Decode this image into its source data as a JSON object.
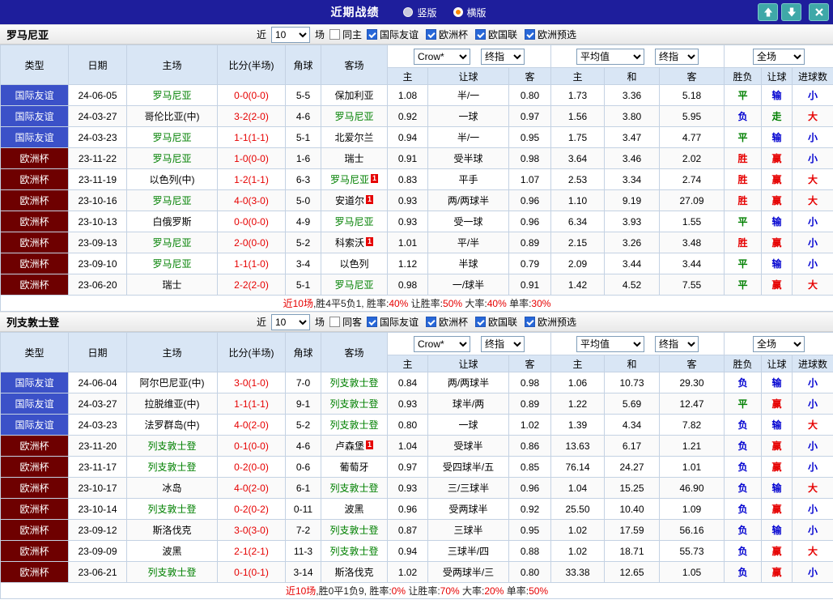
{
  "titlebar": {
    "title": "近期战绩",
    "radios": [
      {
        "label": "竖版",
        "selected": false
      },
      {
        "label": "横版",
        "selected": true
      }
    ]
  },
  "controls": {
    "near_label": "近",
    "count": "10",
    "games_label": "场",
    "bookmaker": "Crow*",
    "close_label": "终指",
    "average": "平均值",
    "fullcourt": "全场"
  },
  "filters": [
    "国际友谊",
    "欧洲杯",
    "欧国联",
    "欧洲预选"
  ],
  "table_headers": {
    "type": "类型",
    "date": "日期",
    "home": "主场",
    "score": "比分(半场)",
    "corner": "角球",
    "away": "客场",
    "a_home": "主",
    "a_handicap": "让球",
    "a_away": "客",
    "e_home": "主",
    "e_draw": "和",
    "e_away": "客",
    "result": "胜负",
    "handicap_result": "让球",
    "goals": "进球数"
  },
  "colors": {
    "titlebar_bg": "#1e1e9c",
    "type_friendly": "#3b51c8",
    "type_eurocup": "#6e0000",
    "team_green": "#008000",
    "red": "#e60000",
    "blue": "#0000d0",
    "green": "#008000",
    "result_map": {
      "胜": "#e60000",
      "平": "#008000",
      "负": "#0000d0",
      "赢": "#e60000",
      "走": "#008000",
      "输": "#0000d0",
      "大": "#e60000",
      "小": "#0000d0"
    }
  },
  "sections": [
    {
      "team": "罗马尼亚",
      "same_label": "同主",
      "rows": [
        {
          "type": "国际友谊",
          "tstyle": "friendly",
          "date": "24-06-05",
          "home": "罗马尼亚",
          "hg": true,
          "hb": false,
          "score": "0-0(0-0)",
          "corner": "5-5",
          "away": "保加利亚",
          "ag": false,
          "ab": false,
          "asian": [
            "1.08",
            "半/一",
            "0.80"
          ],
          "euro": [
            "1.73",
            "3.36",
            "5.18"
          ],
          "results": [
            "平",
            "输",
            "小"
          ]
        },
        {
          "type": "国际友谊",
          "tstyle": "friendly",
          "date": "24-03-27",
          "home": "哥伦比亚(中)",
          "hg": false,
          "hb": false,
          "score": "3-2(2-0)",
          "corner": "4-6",
          "away": "罗马尼亚",
          "ag": true,
          "ab": false,
          "asian": [
            "0.92",
            "一球",
            "0.97"
          ],
          "euro": [
            "1.56",
            "3.80",
            "5.95"
          ],
          "results": [
            "负",
            "走",
            "大"
          ]
        },
        {
          "type": "国际友谊",
          "tstyle": "friendly",
          "date": "24-03-23",
          "home": "罗马尼亚",
          "hg": true,
          "hb": false,
          "score": "1-1(1-1)",
          "corner": "5-1",
          "away": "北爱尔兰",
          "ag": false,
          "ab": false,
          "asian": [
            "0.94",
            "半/一",
            "0.95"
          ],
          "euro": [
            "1.75",
            "3.47",
            "4.77"
          ],
          "results": [
            "平",
            "输",
            "小"
          ]
        },
        {
          "type": "欧洲杯",
          "tstyle": "eurocup",
          "date": "23-11-22",
          "home": "罗马尼亚",
          "hg": true,
          "hb": false,
          "score": "1-0(0-0)",
          "corner": "1-6",
          "away": "瑞士",
          "ag": false,
          "ab": false,
          "asian": [
            "0.91",
            "受半球",
            "0.98"
          ],
          "euro": [
            "3.64",
            "3.46",
            "2.02"
          ],
          "results": [
            "胜",
            "赢",
            "小"
          ]
        },
        {
          "type": "欧洲杯",
          "tstyle": "eurocup",
          "date": "23-11-19",
          "home": "以色列(中)",
          "hg": false,
          "hb": false,
          "score": "1-2(1-1)",
          "corner": "6-3",
          "away": "罗马尼亚",
          "ag": true,
          "ab": true,
          "asian": [
            "0.83",
            "平手",
            "1.07"
          ],
          "euro": [
            "2.53",
            "3.34",
            "2.74"
          ],
          "results": [
            "胜",
            "赢",
            "大"
          ]
        },
        {
          "type": "欧洲杯",
          "tstyle": "eurocup",
          "date": "23-10-16",
          "home": "罗马尼亚",
          "hg": true,
          "hb": false,
          "score": "4-0(3-0)",
          "corner": "5-0",
          "away": "安道尔",
          "ag": false,
          "ab": true,
          "asian": [
            "0.93",
            "两/两球半",
            "0.96"
          ],
          "euro": [
            "1.10",
            "9.19",
            "27.09"
          ],
          "results": [
            "胜",
            "赢",
            "大"
          ]
        },
        {
          "type": "欧洲杯",
          "tstyle": "eurocup",
          "date": "23-10-13",
          "home": "白俄罗斯",
          "hg": false,
          "hb": false,
          "score": "0-0(0-0)",
          "corner": "4-9",
          "away": "罗马尼亚",
          "ag": true,
          "ab": false,
          "asian": [
            "0.93",
            "受一球",
            "0.96"
          ],
          "euro": [
            "6.34",
            "3.93",
            "1.55"
          ],
          "results": [
            "平",
            "输",
            "小"
          ]
        },
        {
          "type": "欧洲杯",
          "tstyle": "eurocup",
          "date": "23-09-13",
          "home": "罗马尼亚",
          "hg": true,
          "hb": false,
          "score": "2-0(0-0)",
          "corner": "5-2",
          "away": "科索沃",
          "ag": false,
          "ab": true,
          "asian": [
            "1.01",
            "平/半",
            "0.89"
          ],
          "euro": [
            "2.15",
            "3.26",
            "3.48"
          ],
          "results": [
            "胜",
            "赢",
            "小"
          ]
        },
        {
          "type": "欧洲杯",
          "tstyle": "eurocup",
          "date": "23-09-10",
          "home": "罗马尼亚",
          "hg": true,
          "hb": false,
          "score": "1-1(1-0)",
          "corner": "3-4",
          "away": "以色列",
          "ag": false,
          "ab": false,
          "asian": [
            "1.12",
            "半球",
            "0.79"
          ],
          "euro": [
            "2.09",
            "3.44",
            "3.44"
          ],
          "results": [
            "平",
            "输",
            "小"
          ]
        },
        {
          "type": "欧洲杯",
          "tstyle": "eurocup",
          "date": "23-06-20",
          "home": "瑞士",
          "hg": false,
          "hb": false,
          "score": "2-2(2-0)",
          "corner": "5-1",
          "away": "罗马尼亚",
          "ag": true,
          "ab": false,
          "asian": [
            "0.98",
            "一/球半",
            "0.91"
          ],
          "euro": [
            "1.42",
            "4.52",
            "7.55"
          ],
          "results": [
            "平",
            "赢",
            "大"
          ]
        }
      ],
      "summary": [
        {
          "t": "近10场",
          "c": "r"
        },
        {
          "t": ",胜4平5负1, 胜率:",
          "c": "k"
        },
        {
          "t": "40%",
          "c": "r"
        },
        {
          "t": " 让胜率:",
          "c": "k"
        },
        {
          "t": "50%",
          "c": "r"
        },
        {
          "t": " 大率:",
          "c": "k"
        },
        {
          "t": "40%",
          "c": "r"
        },
        {
          "t": " 单率:",
          "c": "k"
        },
        {
          "t": "30%",
          "c": "r"
        }
      ]
    },
    {
      "team": "列支敦士登",
      "same_label": "同客",
      "rows": [
        {
          "type": "国际友谊",
          "tstyle": "friendly",
          "date": "24-06-04",
          "home": "阿尔巴尼亚(中)",
          "hg": false,
          "hb": false,
          "score": "3-0(1-0)",
          "corner": "7-0",
          "away": "列支敦士登",
          "ag": true,
          "ab": false,
          "asian": [
            "0.84",
            "两/两球半",
            "0.98"
          ],
          "euro": [
            "1.06",
            "10.73",
            "29.30"
          ],
          "results": [
            "负",
            "输",
            "小"
          ]
        },
        {
          "type": "国际友谊",
          "tstyle": "friendly",
          "date": "24-03-27",
          "home": "拉脱维亚(中)",
          "hg": false,
          "hb": false,
          "score": "1-1(1-1)",
          "corner": "9-1",
          "away": "列支敦士登",
          "ag": true,
          "ab": false,
          "asian": [
            "0.93",
            "球半/两",
            "0.89"
          ],
          "euro": [
            "1.22",
            "5.69",
            "12.47"
          ],
          "results": [
            "平",
            "赢",
            "小"
          ]
        },
        {
          "type": "国际友谊",
          "tstyle": "friendly",
          "date": "24-03-23",
          "home": "法罗群岛(中)",
          "hg": false,
          "hb": false,
          "score": "4-0(2-0)",
          "corner": "5-2",
          "away": "列支敦士登",
          "ag": true,
          "ab": false,
          "asian": [
            "0.80",
            "一球",
            "1.02"
          ],
          "euro": [
            "1.39",
            "4.34",
            "7.82"
          ],
          "results": [
            "负",
            "输",
            "大"
          ]
        },
        {
          "type": "欧洲杯",
          "tstyle": "eurocup",
          "date": "23-11-20",
          "home": "列支敦士登",
          "hg": true,
          "hb": false,
          "score": "0-1(0-0)",
          "corner": "4-6",
          "away": "卢森堡",
          "ag": false,
          "ab": true,
          "asian": [
            "1.04",
            "受球半",
            "0.86"
          ],
          "euro": [
            "13.63",
            "6.17",
            "1.21"
          ],
          "results": [
            "负",
            "赢",
            "小"
          ]
        },
        {
          "type": "欧洲杯",
          "tstyle": "eurocup",
          "date": "23-11-17",
          "home": "列支敦士登",
          "hg": true,
          "hb": false,
          "score": "0-2(0-0)",
          "corner": "0-6",
          "away": "葡萄牙",
          "ag": false,
          "ab": false,
          "asian": [
            "0.97",
            "受四球半/五",
            "0.85"
          ],
          "euro": [
            "76.14",
            "24.27",
            "1.01"
          ],
          "results": [
            "负",
            "赢",
            "小"
          ]
        },
        {
          "type": "欧洲杯",
          "tstyle": "eurocup",
          "date": "23-10-17",
          "home": "冰岛",
          "hg": false,
          "hb": false,
          "score": "4-0(2-0)",
          "corner": "6-1",
          "away": "列支敦士登",
          "ag": true,
          "ab": false,
          "asian": [
            "0.93",
            "三/三球半",
            "0.96"
          ],
          "euro": [
            "1.04",
            "15.25",
            "46.90"
          ],
          "results": [
            "负",
            "输",
            "大"
          ]
        },
        {
          "type": "欧洲杯",
          "tstyle": "eurocup",
          "date": "23-10-14",
          "home": "列支敦士登",
          "hg": true,
          "hb": false,
          "score": "0-2(0-2)",
          "corner": "0-11",
          "away": "波黑",
          "ag": false,
          "ab": false,
          "asian": [
            "0.96",
            "受两球半",
            "0.92"
          ],
          "euro": [
            "25.50",
            "10.40",
            "1.09"
          ],
          "results": [
            "负",
            "赢",
            "小"
          ]
        },
        {
          "type": "欧洲杯",
          "tstyle": "eurocup",
          "date": "23-09-12",
          "home": "斯洛伐克",
          "hg": false,
          "hb": false,
          "score": "3-0(3-0)",
          "corner": "7-2",
          "away": "列支敦士登",
          "ag": true,
          "ab": false,
          "asian": [
            "0.87",
            "三球半",
            "0.95"
          ],
          "euro": [
            "1.02",
            "17.59",
            "56.16"
          ],
          "results": [
            "负",
            "输",
            "小"
          ]
        },
        {
          "type": "欧洲杯",
          "tstyle": "eurocup",
          "date": "23-09-09",
          "home": "波黑",
          "hg": false,
          "hb": false,
          "score": "2-1(2-1)",
          "corner": "11-3",
          "away": "列支敦士登",
          "ag": true,
          "ab": false,
          "asian": [
            "0.94",
            "三球半/四",
            "0.88"
          ],
          "euro": [
            "1.02",
            "18.71",
            "55.73"
          ],
          "results": [
            "负",
            "赢",
            "大"
          ]
        },
        {
          "type": "欧洲杯",
          "tstyle": "eurocup",
          "date": "23-06-21",
          "home": "列支敦士登",
          "hg": true,
          "hb": false,
          "score": "0-1(0-1)",
          "corner": "3-14",
          "away": "斯洛伐克",
          "ag": false,
          "ab": false,
          "asian": [
            "1.02",
            "受两球半/三",
            "0.80"
          ],
          "euro": [
            "33.38",
            "12.65",
            "1.05"
          ],
          "results": [
            "负",
            "赢",
            "小"
          ]
        }
      ],
      "summary": [
        {
          "t": "近10场",
          "c": "r"
        },
        {
          "t": ",胜0平1负9, 胜率:",
          "c": "k"
        },
        {
          "t": "0%",
          "c": "r"
        },
        {
          "t": " 让胜率:",
          "c": "k"
        },
        {
          "t": "70%",
          "c": "r"
        },
        {
          "t": " 大率:",
          "c": "k"
        },
        {
          "t": "20%",
          "c": "r"
        },
        {
          "t": " 单率:",
          "c": "k"
        },
        {
          "t": "50%",
          "c": "r"
        }
      ]
    }
  ]
}
